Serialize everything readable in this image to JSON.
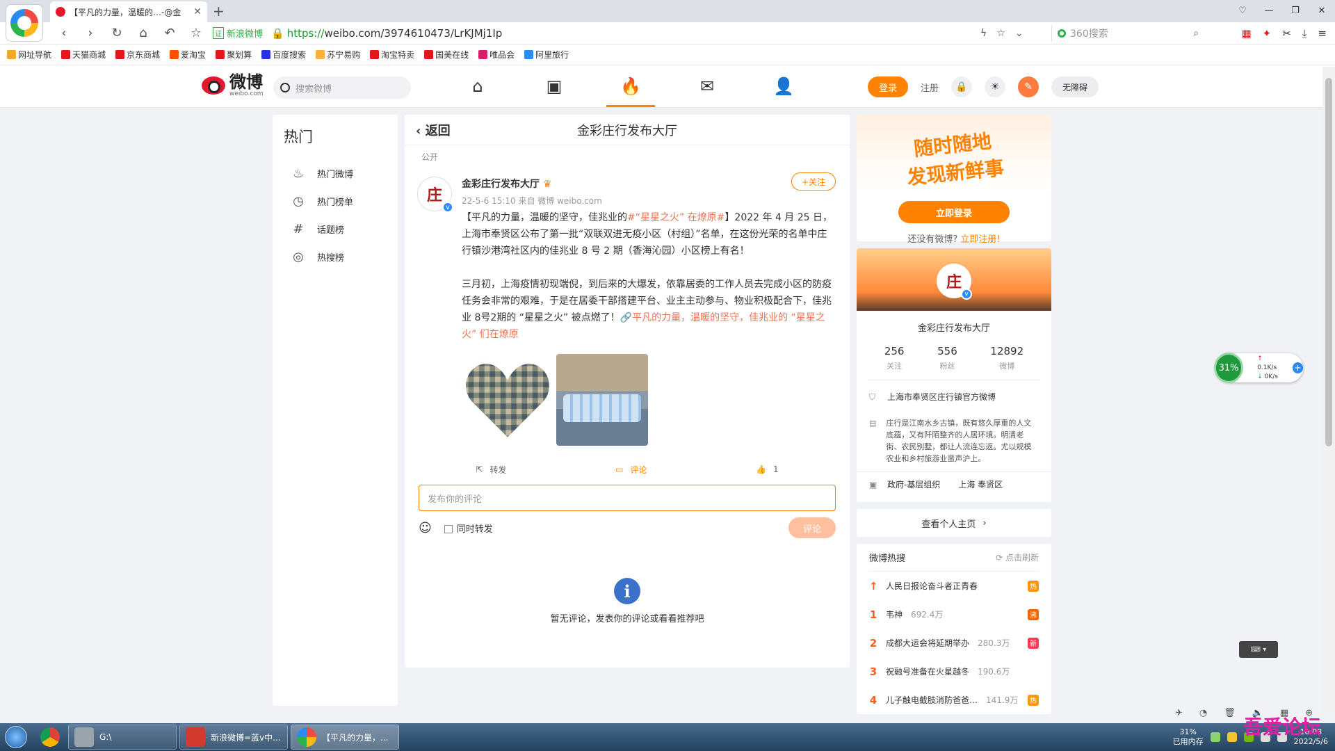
{
  "browser": {
    "tab_title": "【平凡的力量，温暖的…-@金",
    "cert_label": "新浪微博",
    "url_scheme": "https://",
    "url_host": "weibo.com",
    "url_path": "/3974610473/LrKJMj1Ip",
    "search_placeholder": "360搜索",
    "bookmarks": [
      "网址导航",
      "天猫商城",
      "京东商城",
      "爱淘宝",
      "聚划算",
      "百度搜索",
      "苏宁易购",
      "淘宝特卖",
      "国美在线",
      "唯品会",
      "阿里旅行"
    ],
    "bookmark_colors": [
      "#f5a623",
      "#e3161b",
      "#e3161b",
      "#ff5000",
      "#e3161b",
      "#2932e1",
      "#fbb03b",
      "#e3161b",
      "#e3161b",
      "#d41e6c",
      "#2a8bf2"
    ]
  },
  "header": {
    "logo_text": "微博",
    "logo_sub": "weibo.com",
    "search_placeholder": "搜索微博",
    "nav_icons": [
      "home-icon",
      "video-icon",
      "hot-icon",
      "message-icon",
      "profile-icon"
    ],
    "login_label": "登录",
    "register_label": "注册",
    "accessibility_label": "无障碍"
  },
  "left": {
    "title": "热门",
    "items": [
      {
        "label": "热门微博",
        "icon": "flame-icon"
      },
      {
        "label": "热门榜单",
        "icon": "clock-icon"
      },
      {
        "label": "话题榜",
        "icon": "hashtag-icon"
      },
      {
        "label": "热搜榜",
        "icon": "search-ring-icon"
      }
    ]
  },
  "center": {
    "back_label": "返回",
    "title": "金彩庄行发布大厅",
    "visibility": "公开",
    "post": {
      "author": "金彩庄行发布大厅",
      "time": "22-5-6 15:10",
      "source": "来自 微博 weibo.com",
      "follow_label": "+关注",
      "p1_pre": "【平凡的力量，温暖的坚守，佳兆业的",
      "p1_tag": "#“星星之火” 在燎原#",
      "p1_post": "】2022 年 4 月 25 日，上海市奉贤区公布了第一批“双联双进无疫小区（村组）”名单，在这份光荣的名单中庄行镇沙港湾社区内的佳兆业 8 号 2 期（香海沁园）小区榜上有名！",
      "p2_pre": "三月初，上海疫情初现端倪，到后来的大爆发，依靠居委的工作人员去完成小区的防疫任务会非常的艰难，于是在居委干部搭建平台、业主主动参与、物业积极配合下，佳兆业 8号2期的 “星星之火” 被点燃了！",
      "p2_link": "🔗平凡的力量，温暖的坚守，佳兆业的 “星星之火” 们在燎原",
      "repost_label": "转发",
      "comment_label": "评论",
      "like_count": "1"
    },
    "comment_placeholder": "发布你的评论",
    "also_repost_label": "同时转发",
    "comment_button": "评论",
    "empty_text": "暂无评论，发表你的评论或看看推荐吧"
  },
  "right": {
    "slogan_line1": "随时随地",
    "slogan_line2": "发现新鲜事",
    "login_now": "立即登录",
    "no_account": "还没有微博?",
    "register_now": "立即注册!",
    "profile": {
      "name": "金彩庄行发布大厅",
      "following": "256",
      "following_label": "关注",
      "followers": "556",
      "followers_label": "粉丝",
      "posts": "12892",
      "posts_label": "微博",
      "verify": "上海市奉贤区庄行镇官方微博",
      "desc": "庄行是江南水乡古镇，既有悠久厚重的人文底蕴，又有阡陌整齐的人居环境。明清老街、农民别墅，都让人流连忘返。尤以规模农业和乡村旅游业蜚声沪上。",
      "category": "政府-基层组织",
      "location": "上海 奉贤区",
      "view_home": "查看个人主页"
    },
    "hot": {
      "title": "微博热搜",
      "refresh": "点击刷新",
      "items": [
        {
          "rank": "↑",
          "text": "人民日报论奋斗者正青春",
          "count": "",
          "badge": "热",
          "badge_color": "#ff9406"
        },
        {
          "rank": "1",
          "text": "韦神",
          "count": "692.4万",
          "badge": "沸",
          "badge_color": "#f86400"
        },
        {
          "rank": "2",
          "text": "成都大运会将延期举办",
          "count": "280.3万",
          "badge": "新",
          "badge_color": "#ff3852"
        },
        {
          "rank": "3",
          "text": "祝融号准备在火星越冬",
          "count": "190.6万",
          "badge": "",
          "badge_color": ""
        },
        {
          "rank": "4",
          "text": "儿子触电截肢消防爸爸…",
          "count": "141.9万",
          "badge": "热",
          "badge_color": "#ff9406"
        }
      ]
    }
  },
  "widget": {
    "cpu": "31%",
    "up": "0.1K/s",
    "down": "0K/s"
  },
  "taskbar": {
    "items": [
      "G:\\",
      "新浪微博=蓝v中...",
      "【平凡的力量，..."
    ],
    "mem_pct": "31%",
    "mem_label": "已用内存",
    "time": "16:08",
    "date": "2022/5/6"
  },
  "watermark": "吾爱论坛"
}
